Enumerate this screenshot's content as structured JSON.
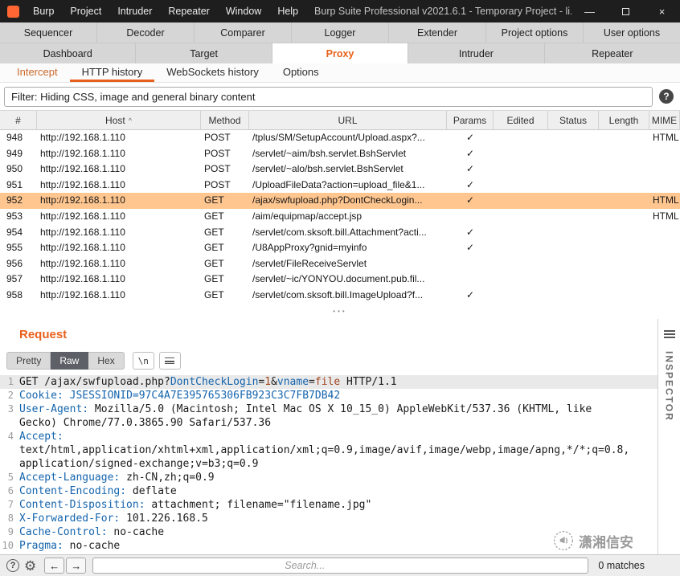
{
  "colors": {
    "accent": "#e8611c",
    "selection": "#ffc690",
    "keyword": "#1464ad",
    "value": "#a2441f",
    "titlebar": "#1e1e1e",
    "burp_orange": "#ff6633"
  },
  "window": {
    "title": "Burp Suite Professional v2021.6.1 - Temporary Project - li...",
    "menus": [
      "Burp",
      "Project",
      "Intruder",
      "Repeater",
      "Window",
      "Help"
    ],
    "minimize_glyph": "—",
    "close_glyph": "×"
  },
  "main_tabs_row1": [
    "Sequencer",
    "Decoder",
    "Comparer",
    "Logger",
    "Extender",
    "Project options",
    "User options"
  ],
  "main_tabs_row2": [
    "Dashboard",
    "Target",
    "Proxy",
    "Intruder",
    "Repeater"
  ],
  "selected_main_tab": "Proxy",
  "sub_tabs": [
    "Intercept",
    "HTTP history",
    "WebSockets history",
    "Options"
  ],
  "selected_sub_tab": "HTTP history",
  "filter": {
    "label": "Filter: Hiding CSS, image and general binary content"
  },
  "icons": {
    "help": "?",
    "gear": "⚙",
    "back": "←",
    "forward": "→"
  },
  "ui": {
    "splitter_dots": "•••"
  },
  "table": {
    "columns": [
      "#",
      "Host",
      "Method",
      "URL",
      "Params",
      "Edited",
      "Status",
      "Length",
      "MIME"
    ],
    "sort_column": "Host",
    "sort_glyph": "^",
    "check_glyph": "✓",
    "selected_row": "952",
    "rows": [
      {
        "num": "948",
        "host": "http://192.168.1.110",
        "method": "POST",
        "url": "/tplus/SM/SetupAccount/Upload.aspx?...",
        "params": true,
        "edited": false,
        "status": "",
        "length": "",
        "mime": "HTML"
      },
      {
        "num": "949",
        "host": "http://192.168.1.110",
        "method": "POST",
        "url": "/servlet/~aim/bsh.servlet.BshServlet",
        "params": true,
        "edited": false,
        "status": "",
        "length": "",
        "mime": ""
      },
      {
        "num": "950",
        "host": "http://192.168.1.110",
        "method": "POST",
        "url": "/servlet/~alo/bsh.servlet.BshServlet",
        "params": true,
        "edited": false,
        "status": "",
        "length": "",
        "mime": ""
      },
      {
        "num": "951",
        "host": "http://192.168.1.110",
        "method": "POST",
        "url": "/UploadFileData?action=upload_file&1...",
        "params": true,
        "edited": false,
        "status": "",
        "length": "",
        "mime": ""
      },
      {
        "num": "952",
        "host": "http://192.168.1.110",
        "method": "GET",
        "url": "/ajax/swfupload.php?DontCheckLogin...",
        "params": true,
        "edited": false,
        "status": "",
        "length": "",
        "mime": "HTML"
      },
      {
        "num": "953",
        "host": "http://192.168.1.110",
        "method": "GET",
        "url": "/aim/equipmap/accept.jsp",
        "params": false,
        "edited": false,
        "status": "",
        "length": "",
        "mime": "HTML"
      },
      {
        "num": "954",
        "host": "http://192.168.1.110",
        "method": "GET",
        "url": "/servlet/com.sksoft.bill.Attachment?acti...",
        "params": true,
        "edited": false,
        "status": "",
        "length": "",
        "mime": ""
      },
      {
        "num": "955",
        "host": "http://192.168.1.110",
        "method": "GET",
        "url": "/U8AppProxy?gnid=myinfo",
        "params": true,
        "edited": false,
        "status": "",
        "length": "",
        "mime": ""
      },
      {
        "num": "956",
        "host": "http://192.168.1.110",
        "method": "GET",
        "url": "/servlet/FileReceiveServlet",
        "params": false,
        "edited": false,
        "status": "",
        "length": "",
        "mime": ""
      },
      {
        "num": "957",
        "host": "http://192.168.1.110",
        "method": "GET",
        "url": "/servlet/~ic/YONYOU.document.pub.fil...",
        "params": false,
        "edited": false,
        "status": "",
        "length": "",
        "mime": ""
      },
      {
        "num": "958",
        "host": "http://192.168.1.110",
        "method": "GET",
        "url": "/servlet/com.sksoft.bill.ImageUpload?f...",
        "params": true,
        "edited": false,
        "status": "",
        "length": "",
        "mime": ""
      }
    ]
  },
  "request": {
    "title": "Request",
    "editor_tabs": [
      "Pretty",
      "Raw",
      "Hex"
    ],
    "selected_editor_tab": "Raw",
    "newline_label": "\\n",
    "inspector_label": "INSPECTOR",
    "lines": [
      {
        "n": "1",
        "highlight": true,
        "segs": [
          [
            "GET /ajax/swfupload.php?",
            "p"
          ],
          [
            "DontCheckLogin",
            "k"
          ],
          [
            "=",
            "p"
          ],
          [
            "1",
            "v"
          ],
          [
            "&",
            "p"
          ],
          [
            "vname",
            "k"
          ],
          [
            "=",
            "p"
          ],
          [
            "file",
            "v"
          ],
          [
            " HTTP/1.1",
            "p"
          ]
        ]
      },
      {
        "n": "2",
        "segs": [
          [
            "Cookie: ",
            "k"
          ],
          [
            "JSESSIONID=97C4A7E395765306FB923C3C7FB7DB42",
            "c"
          ]
        ]
      },
      {
        "n": "3",
        "segs": [
          [
            "User-Agent: ",
            "k"
          ],
          [
            "Mozilla/5.0 (Macintosh; Intel Mac OS X 10_15_0) AppleWebKit/537.36 (KHTML, like Gecko) Chrome/77.0.3865.90 Safari/537.36",
            "p"
          ]
        ]
      },
      {
        "n": "4",
        "segs": [
          [
            "Accept:",
            "k"
          ],
          [
            "\ntext/html,application/xhtml+xml,application/xml;q=0.9,image/avif,image/webp,image/apng,*/*;q=0.8,application/signed-exchange;v=b3;q=0.9",
            "p"
          ]
        ]
      },
      {
        "n": "5",
        "segs": [
          [
            "Accept-Language: ",
            "k"
          ],
          [
            "zh-CN,zh;q=0.9",
            "p"
          ]
        ]
      },
      {
        "n": "6",
        "segs": [
          [
            "Content-Encoding: ",
            "k"
          ],
          [
            "deflate",
            "p"
          ]
        ]
      },
      {
        "n": "7",
        "segs": [
          [
            "Content-Disposition: ",
            "k"
          ],
          [
            "attachment; filename=\"filename.jpg\"",
            "p"
          ]
        ]
      },
      {
        "n": "8",
        "segs": [
          [
            "X-Forwarded-For: ",
            "k"
          ],
          [
            "101.226.168.5",
            "p"
          ]
        ]
      },
      {
        "n": "9",
        "segs": [
          [
            "Cache-Control: ",
            "k"
          ],
          [
            "no-cache",
            "p"
          ]
        ]
      },
      {
        "n": "10",
        "segs": [
          [
            "Pragma: ",
            "k"
          ],
          [
            "no-cache",
            "p"
          ]
        ]
      }
    ]
  },
  "search": {
    "placeholder": "Search...",
    "matches": "0 matches"
  },
  "watermark": {
    "text": "潇湘信安"
  }
}
